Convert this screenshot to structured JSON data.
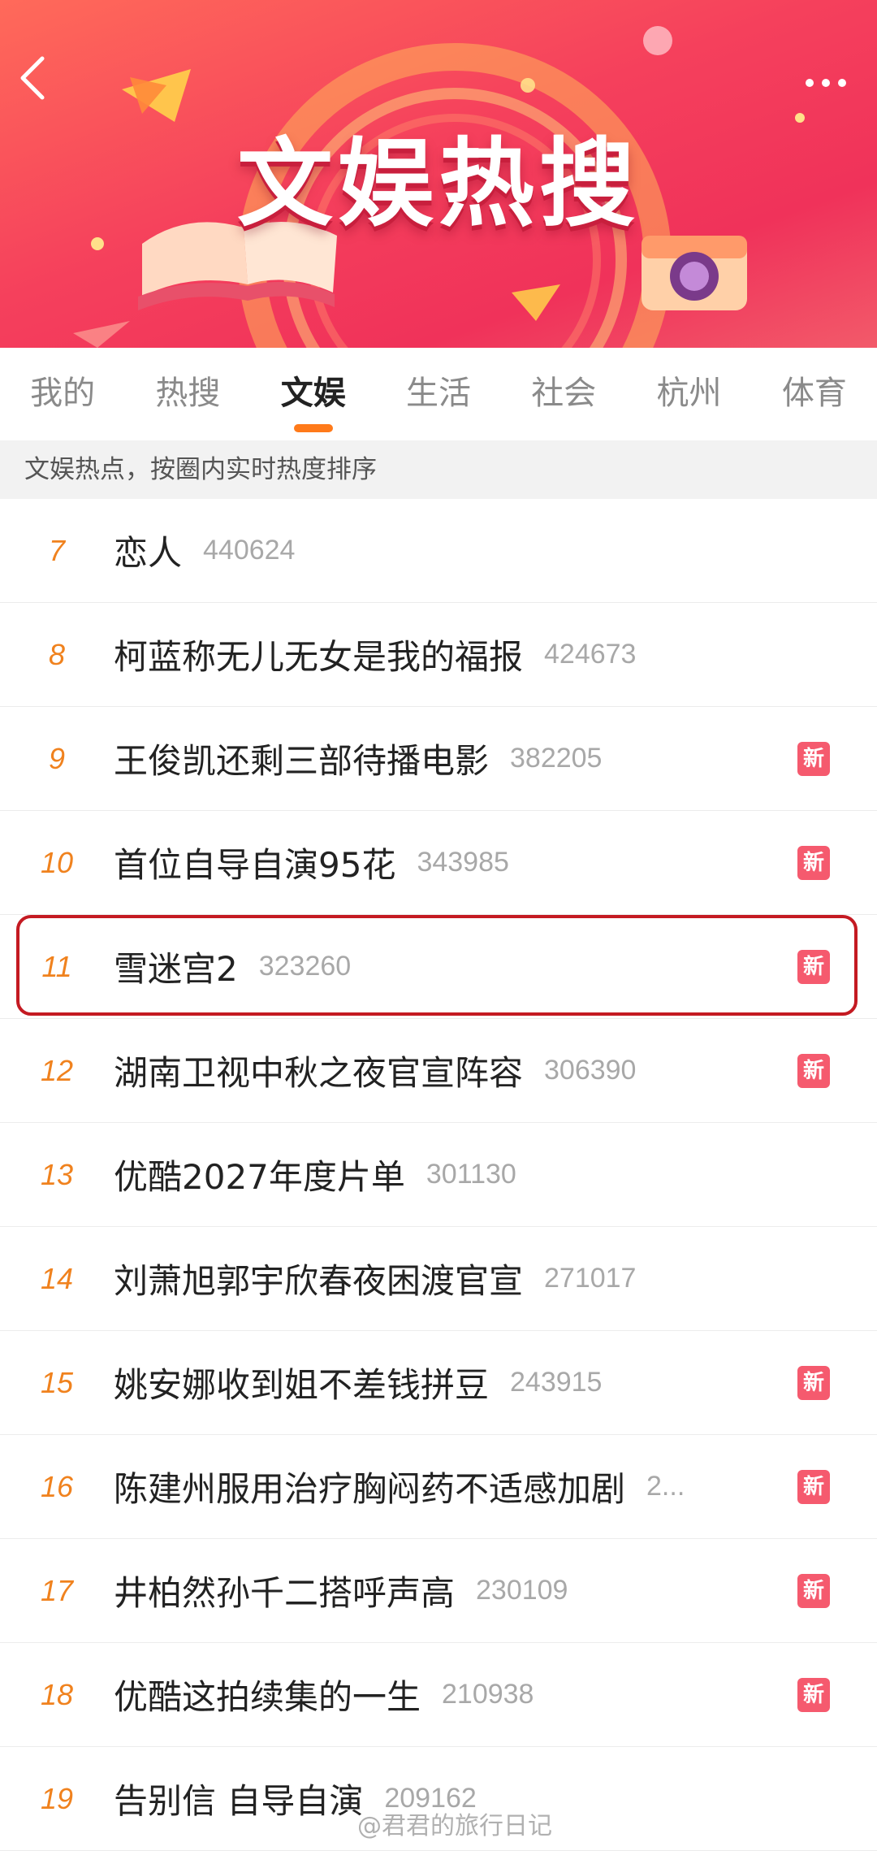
{
  "header": {
    "banner_title": "文娱热搜",
    "back_icon": "chevron-left-icon",
    "more_icon": "more-dots-icon"
  },
  "tabs": [
    {
      "label": "我的",
      "active": false
    },
    {
      "label": "热搜",
      "active": false
    },
    {
      "label": "文娱",
      "active": true
    },
    {
      "label": "生活",
      "active": false
    },
    {
      "label": "社会",
      "active": false
    },
    {
      "label": "杭州",
      "active": false
    },
    {
      "label": "体育",
      "active": false
    }
  ],
  "subheader": "文娱热点，按圈内实时热度排序",
  "items": [
    {
      "rank": "7",
      "title": "恋人",
      "count": "440624",
      "badge": ""
    },
    {
      "rank": "8",
      "title": "柯蓝称无儿无女是我的福报",
      "count": "424673",
      "badge": ""
    },
    {
      "rank": "9",
      "title": "王俊凯还剩三部待播电影",
      "count": "382205",
      "badge": "新"
    },
    {
      "rank": "10",
      "title": "首位自导自演95花",
      "count": "343985",
      "badge": "新"
    },
    {
      "rank": "11",
      "title": "雪迷宫2",
      "count": "323260",
      "badge": "新"
    },
    {
      "rank": "12",
      "title": "湖南卫视中秋之夜官宣阵容",
      "count": "306390",
      "badge": "新"
    },
    {
      "rank": "13",
      "title": "优酷2027年度片单",
      "count": "301130",
      "badge": ""
    },
    {
      "rank": "14",
      "title": "刘萧旭郭宇欣春夜困渡官宣",
      "count": "271017",
      "badge": ""
    },
    {
      "rank": "15",
      "title": "姚安娜收到姐不差钱拼豆",
      "count": "243915",
      "badge": "新"
    },
    {
      "rank": "16",
      "title": "陈建州服用治疗胸闷药不适感加剧",
      "count": "2...",
      "badge": "新"
    },
    {
      "rank": "17",
      "title": "井柏然孙千二搭呼声高",
      "count": "230109",
      "badge": "新"
    },
    {
      "rank": "18",
      "title": "优酷这拍续集的一生",
      "count": "210938",
      "badge": "新"
    },
    {
      "rank": "19",
      "title": "告别信 自导自演",
      "count": "209162",
      "badge": ""
    }
  ],
  "watermark": "@君君的旅行日记",
  "colors": {
    "rank": "#f0821e",
    "badge": "#f55a6e",
    "tab_indicator": "#ff7a1a",
    "highlight_border": "#c41a22"
  }
}
